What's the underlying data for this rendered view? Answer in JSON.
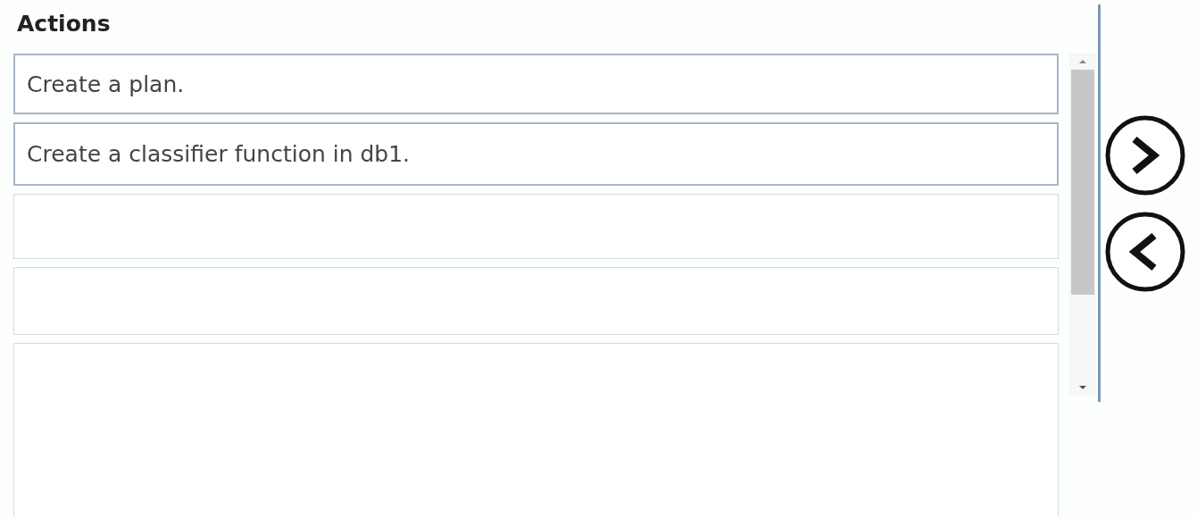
{
  "heading": "Actions",
  "slots": [
    {
      "kind": "action",
      "text": "Create a plan."
    },
    {
      "kind": "action",
      "text": "Create a classifier function in db1."
    },
    {
      "kind": "empty"
    },
    {
      "kind": "empty"
    },
    {
      "kind": "empty"
    }
  ]
}
